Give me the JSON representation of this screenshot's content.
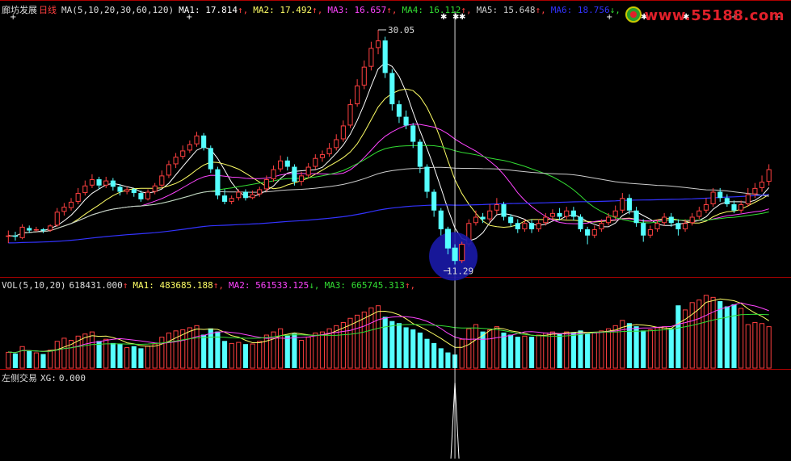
{
  "stock": {
    "name": "廊坊发展",
    "period": "日线"
  },
  "ma_header": {
    "params": "MA(5,10,20,30,60,120)",
    "items": [
      {
        "label": "MA1:",
        "value": "17.814",
        "arrow": "↑",
        "color": "#ffffff"
      },
      {
        "label": "MA2:",
        "value": "17.492",
        "arrow": "↑",
        "color": "#ffff66"
      },
      {
        "label": "MA3:",
        "value": "16.657",
        "arrow": "↑",
        "color": "#ff44ff"
      },
      {
        "label": "MA4:",
        "value": "16.112",
        "arrow": "↑",
        "color": "#33dd33"
      },
      {
        "label": "MA5:",
        "value": "15.648",
        "arrow": "↑",
        "color": "#cccccc"
      },
      {
        "label": "MA6:",
        "value": "18.756",
        "arrow": "↓",
        "color": "#3333ff"
      }
    ]
  },
  "vol_header": {
    "params": "VOL(5,10,20)",
    "vol_value": "618431.000",
    "vol_arrow": "↑",
    "items": [
      {
        "label": "MA1:",
        "value": "483685.188",
        "arrow": "↑",
        "color": "#ffff66"
      },
      {
        "label": "MA2:",
        "value": "561533.125",
        "arrow": "↓",
        "color": "#ff44ff"
      },
      {
        "label": "MA3:",
        "value": "665745.313",
        "arrow": "↑",
        "color": "#33dd33"
      }
    ]
  },
  "indicator_header": {
    "name": "左侧交易",
    "label": "XG:",
    "value": "0.000"
  },
  "price_annotations": {
    "high": "30.05",
    "low": "11.29"
  },
  "watermark": "www.55188.com",
  "colors": {
    "up": "#ff4040",
    "down": "#55ffff",
    "ma5": "#ffffff",
    "ma10": "#ffff66",
    "ma20": "#ff44ff",
    "ma30": "#33dd33",
    "ma60": "#cccccc",
    "ma120": "#3333ff",
    "grid": "#aa0000",
    "highlight": "#1a1aa8"
  },
  "chart_data": {
    "type": "candlestick",
    "price_range": [
      11.29,
      30.05
    ],
    "candles": [
      [
        13.5,
        13.6,
        13.0,
        14.0
      ],
      [
        13.6,
        13.5,
        13.2,
        13.9
      ],
      [
        13.4,
        14.3,
        13.3,
        14.5
      ],
      [
        14.2,
        14.0,
        13.8,
        14.4
      ],
      [
        14.0,
        14.1,
        13.9,
        14.3
      ],
      [
        14.1,
        14.0,
        13.8,
        14.2
      ],
      [
        14.0,
        14.4,
        13.9,
        14.5
      ],
      [
        14.4,
        15.5,
        14.3,
        15.8
      ],
      [
        15.5,
        15.9,
        15.2,
        16.2
      ],
      [
        15.8,
        16.3,
        15.6,
        16.6
      ],
      [
        16.3,
        17.0,
        16.1,
        17.4
      ],
      [
        17.0,
        17.6,
        16.8,
        18.0
      ],
      [
        17.6,
        18.1,
        17.4,
        18.5
      ],
      [
        18.1,
        17.6,
        17.3,
        18.3
      ],
      [
        17.6,
        18.0,
        17.4,
        18.3
      ],
      [
        18.0,
        17.5,
        17.2,
        18.2
      ],
      [
        17.5,
        17.1,
        16.8,
        17.7
      ],
      [
        17.1,
        17.3,
        16.9,
        17.5
      ],
      [
        17.3,
        17.0,
        16.7,
        17.4
      ],
      [
        17.0,
        16.5,
        16.3,
        17.2
      ],
      [
        16.5,
        17.1,
        16.4,
        17.3
      ],
      [
        17.1,
        17.6,
        16.9,
        17.8
      ],
      [
        17.6,
        18.4,
        17.4,
        18.8
      ],
      [
        18.4,
        19.3,
        18.2,
        19.6
      ],
      [
        19.3,
        19.9,
        19.0,
        20.2
      ],
      [
        19.9,
        20.4,
        19.7,
        20.8
      ],
      [
        20.4,
        20.9,
        20.2,
        21.2
      ],
      [
        20.9,
        21.6,
        20.7,
        21.9
      ],
      [
        21.6,
        20.6,
        20.4,
        21.8
      ],
      [
        20.6,
        18.9,
        18.6,
        20.8
      ],
      [
        18.9,
        16.8,
        16.5,
        19.1
      ],
      [
        16.8,
        16.3,
        16.1,
        17.3
      ],
      [
        16.3,
        16.6,
        16.1,
        16.8
      ],
      [
        16.6,
        17.1,
        16.4,
        17.3
      ],
      [
        17.1,
        16.6,
        16.4,
        17.3
      ],
      [
        16.6,
        16.9,
        16.5,
        17.2
      ],
      [
        16.9,
        17.3,
        16.7,
        17.5
      ],
      [
        17.3,
        18.1,
        17.1,
        18.4
      ],
      [
        18.1,
        18.9,
        17.9,
        19.2
      ],
      [
        18.9,
        19.6,
        18.7,
        20.0
      ],
      [
        19.6,
        19.1,
        18.8,
        19.9
      ],
      [
        19.1,
        17.9,
        17.6,
        19.3
      ],
      [
        17.9,
        18.4,
        17.6,
        18.7
      ],
      [
        18.4,
        19.1,
        18.2,
        19.4
      ],
      [
        19.1,
        19.8,
        18.9,
        20.1
      ],
      [
        19.8,
        20.1,
        19.5,
        20.4
      ],
      [
        20.1,
        20.6,
        19.9,
        21.0
      ],
      [
        20.6,
        21.3,
        20.4,
        21.7
      ],
      [
        21.3,
        22.4,
        21.1,
        22.8
      ],
      [
        22.4,
        24.1,
        22.2,
        24.5
      ],
      [
        24.1,
        25.6,
        23.9,
        26.1
      ],
      [
        25.6,
        27.1,
        25.3,
        27.6
      ],
      [
        27.1,
        28.6,
        26.8,
        29.1
      ],
      [
        28.6,
        29.2,
        28.1,
        30.05
      ],
      [
        29.2,
        26.6,
        26.2,
        29.5
      ],
      [
        26.6,
        24.1,
        23.6,
        26.9
      ],
      [
        24.1,
        23.1,
        22.6,
        24.4
      ],
      [
        23.1,
        22.4,
        22.1,
        23.6
      ],
      [
        22.4,
        21.1,
        20.6,
        22.6
      ],
      [
        21.1,
        19.1,
        18.6,
        21.3
      ],
      [
        19.1,
        17.1,
        16.6,
        19.3
      ],
      [
        17.1,
        15.6,
        15.1,
        17.3
      ],
      [
        15.6,
        14.1,
        13.6,
        15.8
      ],
      [
        14.1,
        12.6,
        12.1,
        14.3
      ],
      [
        12.6,
        11.6,
        11.29,
        12.9
      ],
      [
        11.6,
        12.9,
        11.4,
        13.1
      ],
      [
        12.9,
        14.6,
        12.7,
        14.9
      ],
      [
        14.6,
        15.1,
        14.4,
        15.6
      ],
      [
        15.1,
        14.9,
        14.6,
        15.4
      ],
      [
        14.9,
        15.6,
        14.7,
        16.1
      ],
      [
        15.6,
        16.1,
        15.3,
        16.6
      ],
      [
        16.1,
        15.1,
        14.8,
        16.3
      ],
      [
        15.1,
        14.6,
        14.3,
        15.3
      ],
      [
        14.6,
        14.1,
        13.8,
        14.9
      ],
      [
        14.1,
        14.6,
        13.9,
        14.9
      ],
      [
        14.6,
        14.1,
        13.8,
        14.9
      ],
      [
        14.1,
        14.6,
        13.9,
        14.9
      ],
      [
        14.6,
        15.1,
        14.4,
        15.4
      ],
      [
        15.1,
        15.4,
        14.9,
        15.7
      ],
      [
        15.4,
        15.1,
        14.8,
        15.8
      ],
      [
        15.1,
        15.6,
        14.9,
        15.9
      ],
      [
        15.6,
        15.1,
        14.8,
        15.9
      ],
      [
        15.1,
        14.1,
        13.9,
        15.3
      ],
      [
        14.1,
        13.6,
        12.9,
        14.3
      ],
      [
        13.6,
        14.1,
        13.4,
        14.4
      ],
      [
        14.1,
        14.6,
        13.9,
        14.9
      ],
      [
        14.6,
        15.1,
        14.4,
        15.4
      ],
      [
        15.1,
        15.6,
        14.9,
        16.0
      ],
      [
        15.6,
        16.6,
        15.4,
        17.0
      ],
      [
        16.6,
        15.6,
        15.3,
        16.9
      ],
      [
        15.6,
        14.6,
        14.3,
        15.9
      ],
      [
        14.6,
        13.6,
        13.1,
        14.9
      ],
      [
        13.6,
        14.1,
        13.4,
        14.4
      ],
      [
        14.1,
        14.6,
        13.9,
        14.9
      ],
      [
        14.6,
        15.1,
        14.4,
        15.4
      ],
      [
        15.1,
        14.6,
        14.3,
        15.4
      ],
      [
        14.6,
        14.1,
        13.6,
        14.9
      ],
      [
        14.1,
        14.6,
        13.9,
        14.9
      ],
      [
        14.6,
        15.1,
        14.4,
        15.4
      ],
      [
        15.1,
        15.6,
        14.9,
        15.9
      ],
      [
        15.6,
        16.1,
        15.4,
        16.6
      ],
      [
        16.1,
        17.1,
        15.9,
        17.4
      ],
      [
        17.1,
        16.6,
        16.3,
        17.4
      ],
      [
        16.6,
        16.1,
        15.9,
        16.9
      ],
      [
        16.1,
        15.6,
        15.4,
        16.4
      ],
      [
        15.6,
        16.1,
        15.4,
        16.4
      ],
      [
        16.1,
        16.9,
        15.9,
        17.4
      ],
      [
        16.9,
        17.4,
        16.6,
        17.8
      ],
      [
        17.4,
        17.9,
        17.1,
        18.4
      ],
      [
        17.9,
        18.9,
        17.6,
        19.3
      ]
    ],
    "volume": [
      310,
      280,
      420,
      330,
      300,
      270,
      350,
      520,
      580,
      540,
      620,
      660,
      700,
      520,
      560,
      480,
      460,
      400,
      420,
      380,
      430,
      470,
      600,
      680,
      720,
      740,
      780,
      820,
      640,
      760,
      700,
      520,
      480,
      500,
      460,
      470,
      520,
      640,
      700,
      760,
      620,
      660,
      540,
      600,
      680,
      700,
      760,
      820,
      880,
      960,
      1020,
      1080,
      1160,
      1200,
      980,
      900,
      860,
      780,
      740,
      680,
      560,
      480,
      380,
      300,
      260,
      560,
      760,
      840,
      700,
      740,
      800,
      680,
      640,
      600,
      620,
      600,
      640,
      680,
      700,
      660,
      700,
      680,
      720,
      660,
      680,
      720,
      760,
      820,
      920,
      860,
      800,
      720,
      740,
      780,
      800,
      760,
      720,
      740,
      780,
      820,
      860,
      920,
      880,
      820,
      780,
      800,
      840,
      880,
      860,
      800
    ],
    "volume_highlight": [
      1200,
      1120,
      1260,
      1310,
      1400,
      1360,
      1280,
      1180,
      1220,
      1150
    ],
    "indicator": {
      "signal_index": 64,
      "value": 0.0
    }
  }
}
